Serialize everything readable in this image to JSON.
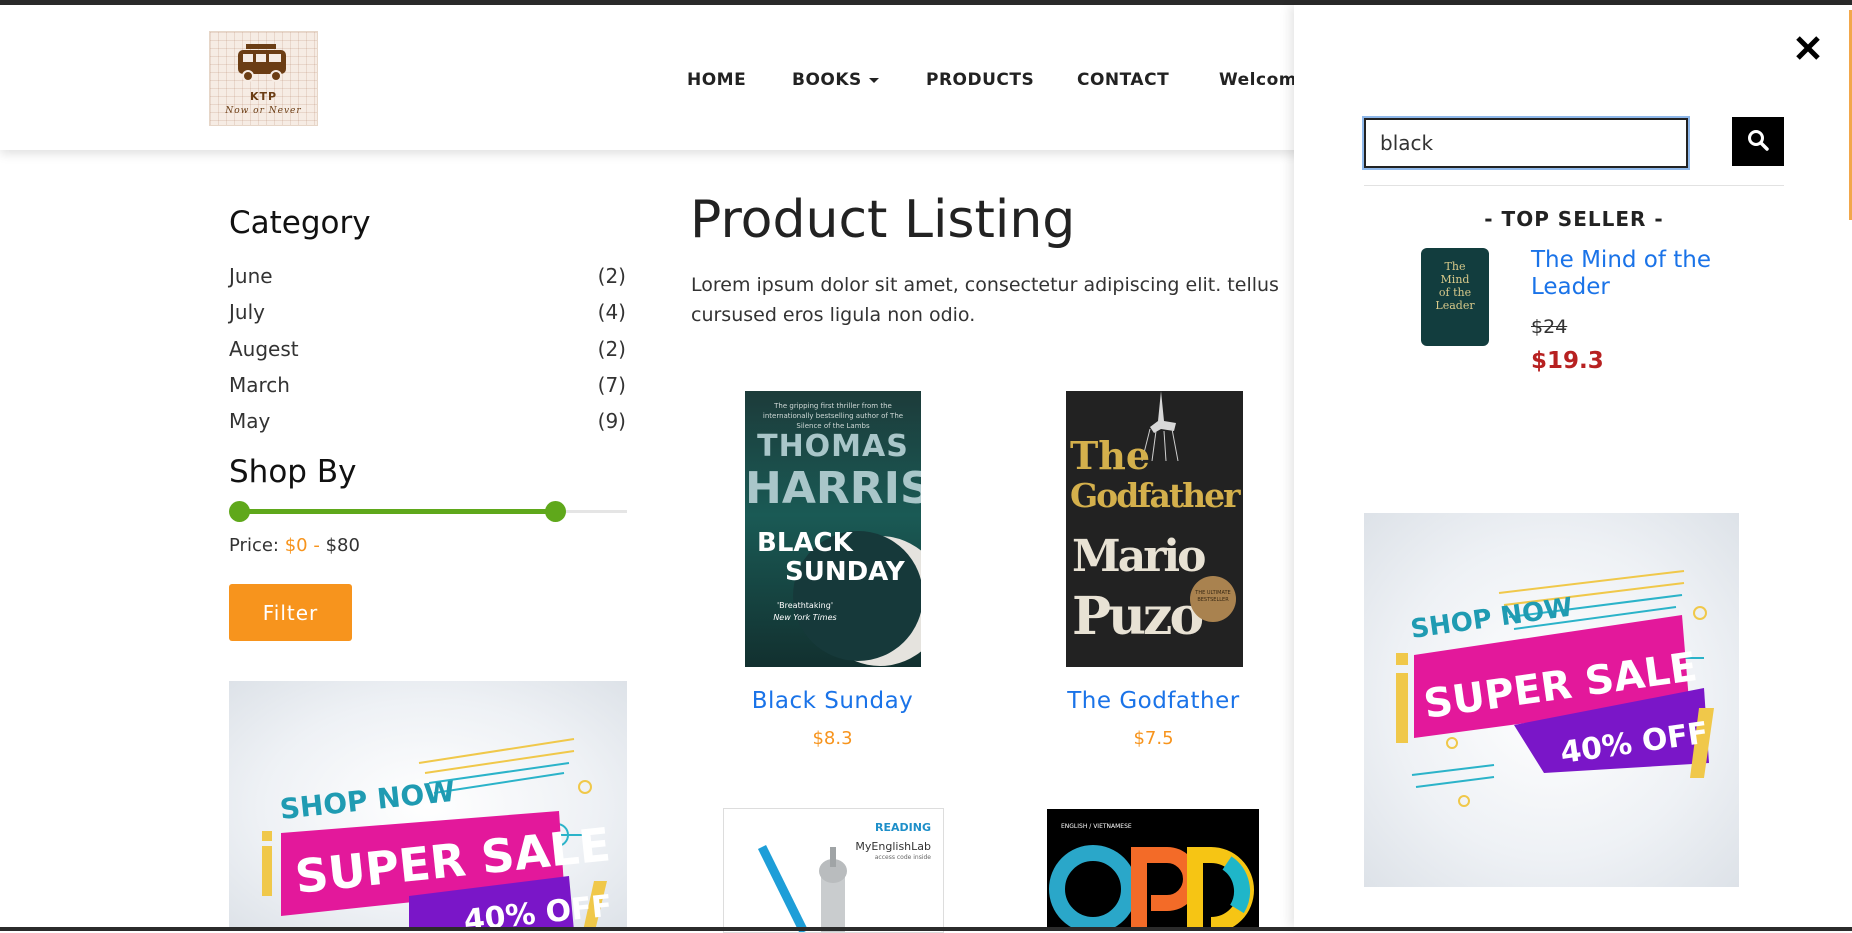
{
  "header": {
    "logo": {
      "name": "KTP",
      "tagline": "Now or Never"
    },
    "nav": {
      "home": "HOME",
      "books": "BOOKS",
      "products": "PRODUCTS",
      "contact": "CONTACT",
      "welcome": "Welcom"
    }
  },
  "sidebar": {
    "category_title": "Category",
    "categories": [
      {
        "label": "June",
        "count": "(2)"
      },
      {
        "label": "July",
        "count": "(4)"
      },
      {
        "label": "Augest",
        "count": "(2)"
      },
      {
        "label": "March",
        "count": "(7)"
      },
      {
        "label": "May",
        "count": "(9)"
      }
    ],
    "shop_by_title": "Shop By",
    "price_label": "Price:",
    "price_min": "$0",
    "price_sep": "-",
    "price_max": "$80",
    "filter_label": "Filter"
  },
  "main": {
    "title": "Product Listing",
    "description": "Lorem ipsum dolor sit amet, consectetur adipiscing elit. tellus cursused eros ligula non odio.",
    "products": [
      {
        "title": "Black Sunday",
        "price": "$8.3",
        "cover_top": "The gripping first thriller from the internationally bestselling author of The Silence of the Lambs",
        "cover_author1": "THOMAS",
        "cover_author2": "HARRIS",
        "cover_title1": "BLACK",
        "cover_title2": "SUNDAY",
        "cover_quote1": "'Breathtaking'",
        "cover_quote2": "New York Times"
      },
      {
        "title": "The Godfather",
        "price": "$7.5",
        "cover_title1": "The",
        "cover_title2": "Godfather",
        "cover_author1": "Mario",
        "cover_author2": "Puzo",
        "cover_seal": "THE ULTIMATE BESTSELLER"
      },
      {
        "cover_label": "READING",
        "cover_brand": "MyEnglishLab",
        "cover_sub": "access code inside"
      },
      {
        "cover_label": "ENGLISH / VIETNAMESE",
        "cover_text": "OPD"
      }
    ]
  },
  "promo": {
    "shop_now": "SHOP NOW",
    "super_sale": "SUPER SALE",
    "discount": "40% OFF"
  },
  "search_panel": {
    "close_icon": "close-icon",
    "query": "black",
    "top_seller_heading": "- TOP SELLER -",
    "top_seller": {
      "title": "The Mind of the Leader",
      "old_price": "$24",
      "new_price": "$19.3",
      "cover_text1": "The",
      "cover_text2": "Mind",
      "cover_text3": "of the",
      "cover_text4": "Leader"
    }
  },
  "colors": {
    "accent_orange": "#f7941d",
    "link_blue": "#1a73e8",
    "sale_red": "#b72121",
    "slider_green": "#5fa81b"
  }
}
